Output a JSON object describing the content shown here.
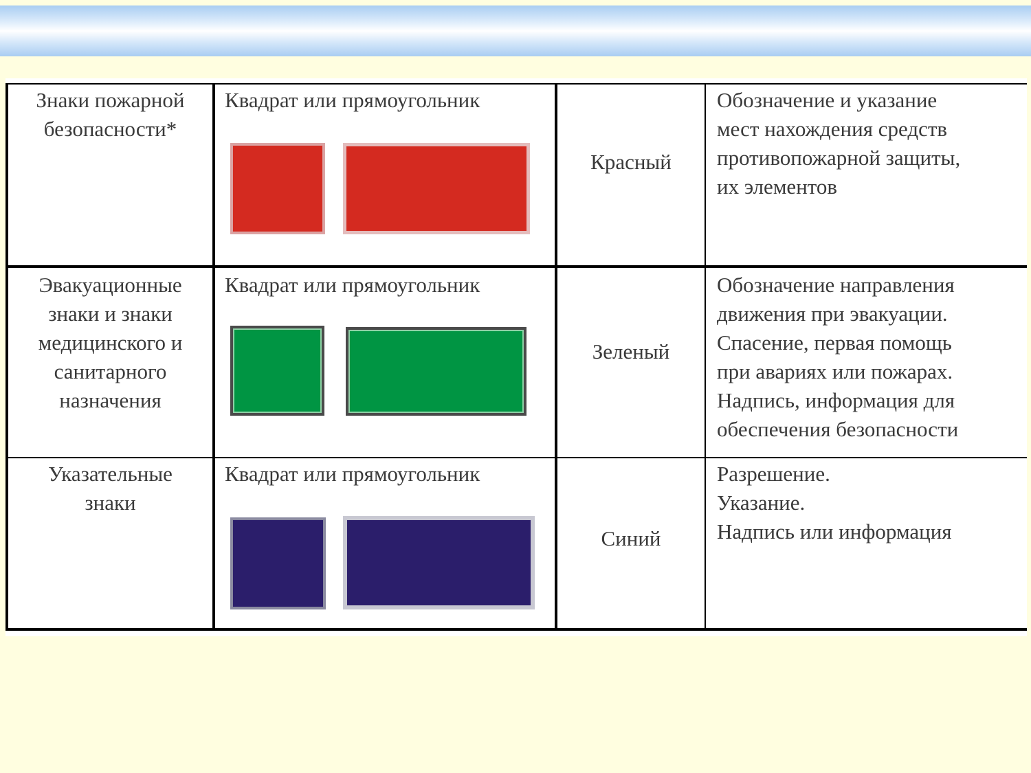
{
  "table": {
    "rows": [
      {
        "category_lines": [
          "Знаки пожарной",
          "безопасности*"
        ],
        "shape": "Квадрат или прямоугольник",
        "color_name": "Красный",
        "description_lines": [
          "Обозначение и указание",
          "мест нахождения средств",
          "противопожарной защиты,",
          "их элементов"
        ],
        "fill": "#d42a20"
      },
      {
        "category_lines": [
          "Эвакуационные",
          "знаки  и знаки",
          "медицинского и",
          "санитарного",
          "назначения"
        ],
        "shape": "Квадрат или прямоугольник",
        "color_name": "Зеленый",
        "description_lines": [
          "Обозначение направления",
          "движения при эвакуации.",
          "Спасение, первая помощь",
          "при авариях или пожарах.",
          "Надпись,  информация для",
          "обеспечения безопасности"
        ],
        "fill": "#009543"
      },
      {
        "category_lines": [
          "Указательные",
          "знаки"
        ],
        "shape": "Квадрат или прямоугольник",
        "color_name": "Синий",
        "description_lines": [
          "Разрешение.",
          "Указание.",
          "Надпись или информация"
        ],
        "fill": "#2b1e6b"
      }
    ]
  }
}
